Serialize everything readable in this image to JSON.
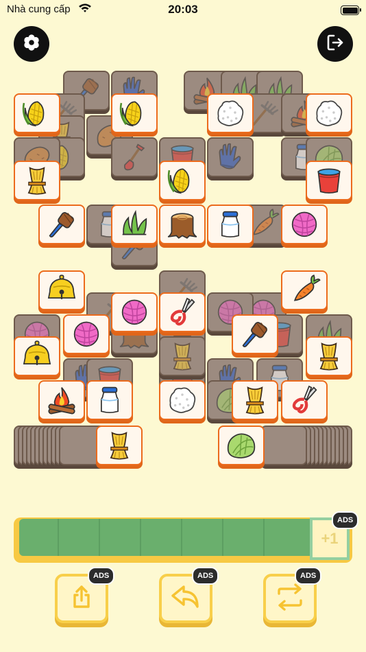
{
  "status_bar": {
    "carrier": "Nhà cung cấp",
    "time": "20:03",
    "wifi_icon": "wifi-icon",
    "battery_icon": "battery-icon"
  },
  "header": {
    "settings_icon": "gear-icon",
    "exit_icon": "exit-icon"
  },
  "colors": {
    "background": "#fdf9d2",
    "tile_face": "#fff7ed",
    "tile_border": "#ec6b1d",
    "tile_covered": "#9c8b80",
    "tray": "#f7c943",
    "tray_slots": "#6aaf6d",
    "button_face": "#fff6c8",
    "button_border": "#f8cf4a"
  },
  "board": {
    "free_tiles": [
      "corn",
      "corn",
      "rice",
      "rice",
      "wheat",
      "corn",
      "bucket",
      "brush",
      "sprout",
      "stump",
      "milk",
      "yarn",
      "bell",
      "carrot",
      "yarn",
      "shears",
      "yarn",
      "brush",
      "bell",
      "wheat",
      "campfire",
      "milk",
      "rice",
      "wheat",
      "shears",
      "wheat",
      "cabbage"
    ],
    "covered_tiles": [
      "brush",
      "gloves",
      "campfire",
      "sprout",
      "sprout",
      "rake",
      "sweetpotato",
      "wheat",
      "rake",
      "campfire",
      "corn",
      "sweetpotato",
      "bucket",
      "sweetpotato",
      "milk",
      "cabbage",
      "shovel",
      "gloves",
      "milk",
      "carrot",
      "wheat",
      "brush",
      "rake",
      "yarn",
      "rake",
      "yarn",
      "yarn",
      "stump",
      "wheat",
      "bucket",
      "sprout",
      "gloves",
      "bucket",
      "gloves",
      "milk",
      "bucket",
      "cabbage",
      "wheat"
    ],
    "stack_left_count": 12,
    "stack_right_count": 12
  },
  "tray": {
    "slot_count": 7,
    "slots": [
      "",
      "",
      "",
      "",
      "",
      "",
      ""
    ],
    "extra_slot_label": "+1",
    "extra_slot_badge": "ADS"
  },
  "tools": [
    {
      "name": "pop-out",
      "icon": "share-up-icon",
      "badge": "ADS"
    },
    {
      "name": "undo",
      "icon": "undo-icon",
      "badge": "ADS"
    },
    {
      "name": "shuffle",
      "icon": "shuffle-icon",
      "badge": "ADS"
    }
  ]
}
